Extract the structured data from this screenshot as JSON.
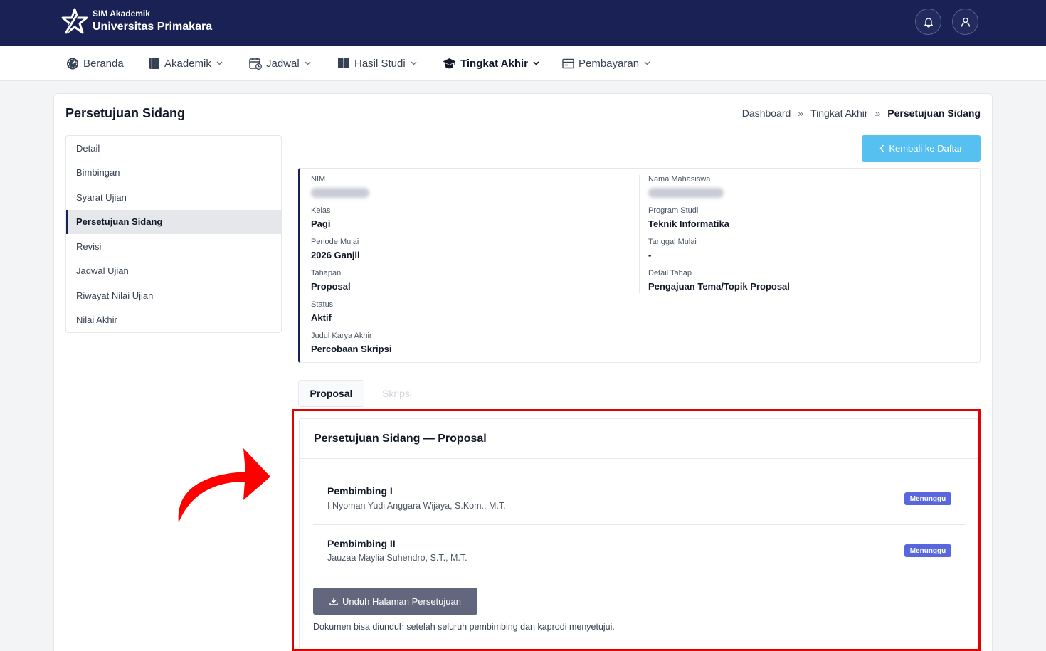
{
  "brand": {
    "sub": "SIM Akademik",
    "title": "Universitas Primakara"
  },
  "nav": [
    {
      "label": "Beranda",
      "icon": "dashboard-icon",
      "dropdown": false,
      "active": false
    },
    {
      "label": "Akademik",
      "icon": "book-icon",
      "dropdown": true,
      "active": false
    },
    {
      "label": "Jadwal",
      "icon": "calendar-icon",
      "dropdown": true,
      "active": false
    },
    {
      "label": "Hasil Studi",
      "icon": "open-book-icon",
      "dropdown": true,
      "active": false
    },
    {
      "label": "Tingkat Akhir",
      "icon": "graduation-cap-icon",
      "dropdown": true,
      "active": true
    },
    {
      "label": "Pembayaran",
      "icon": "wallet-icon",
      "dropdown": true,
      "active": false
    }
  ],
  "page": {
    "title": "Persetujuan Sidang",
    "breadcrumb": [
      "Dashboard",
      "Tingkat Akhir",
      "Persetujuan Sidang"
    ],
    "breadcrumb_sep": "»",
    "back_label": "Kembali ke Daftar"
  },
  "side_menu": [
    "Detail",
    "Bimbingan",
    "Syarat Ujian",
    "Persetujuan Sidang",
    "Revisi",
    "Jadwal Ujian",
    "Riwayat Nilai Ujian",
    "Nilai Akhir"
  ],
  "side_menu_active": "Persetujuan Sidang",
  "info": {
    "nim_label": "NIM",
    "nama_label": "Nama Mahasiswa",
    "kelas": {
      "label": "Kelas",
      "value": "Pagi"
    },
    "prodi": {
      "label": "Program Studi",
      "value": "Teknik Informatika"
    },
    "periode": {
      "label": "Periode Mulai",
      "value": "2026 Ganjil"
    },
    "tanggal": {
      "label": "Tanggal Mulai",
      "value": "-"
    },
    "tahapan": {
      "label": "Tahapan",
      "value": "Proposal"
    },
    "detail_tahap": {
      "label": "Detail Tahap",
      "value": "Pengajuan Tema/Topik Proposal"
    },
    "status": {
      "label": "Status",
      "value": "Aktif"
    },
    "judul": {
      "label": "Judul Karya Akhir",
      "value": "Percobaan Skripsi"
    }
  },
  "tabs": {
    "proposal": "Proposal",
    "skripsi": "Skripsi"
  },
  "approval": {
    "title": "Persetujuan Sidang — Proposal",
    "supervisors": [
      {
        "role": "Pembimbing I",
        "name": "I Nyoman Yudi Anggara Wijaya, S.Kom., M.T.",
        "status": "Menunggu"
      },
      {
        "role": "Pembimbing II",
        "name": "Jauzaa Maylia Suhendro, S.T., M.T.",
        "status": "Menunggu"
      }
    ],
    "download_label": "Unduh Halaman Persetujuan",
    "note": "Dokumen bisa diunduh setelah seluruh pembimbing dan kaprodi menyetujui."
  },
  "colors": {
    "topbar": "#1a2154",
    "accent_button": "#56c1f0",
    "badge": "#5867dd",
    "highlight": "#e30000",
    "download_button": "#62677e"
  }
}
